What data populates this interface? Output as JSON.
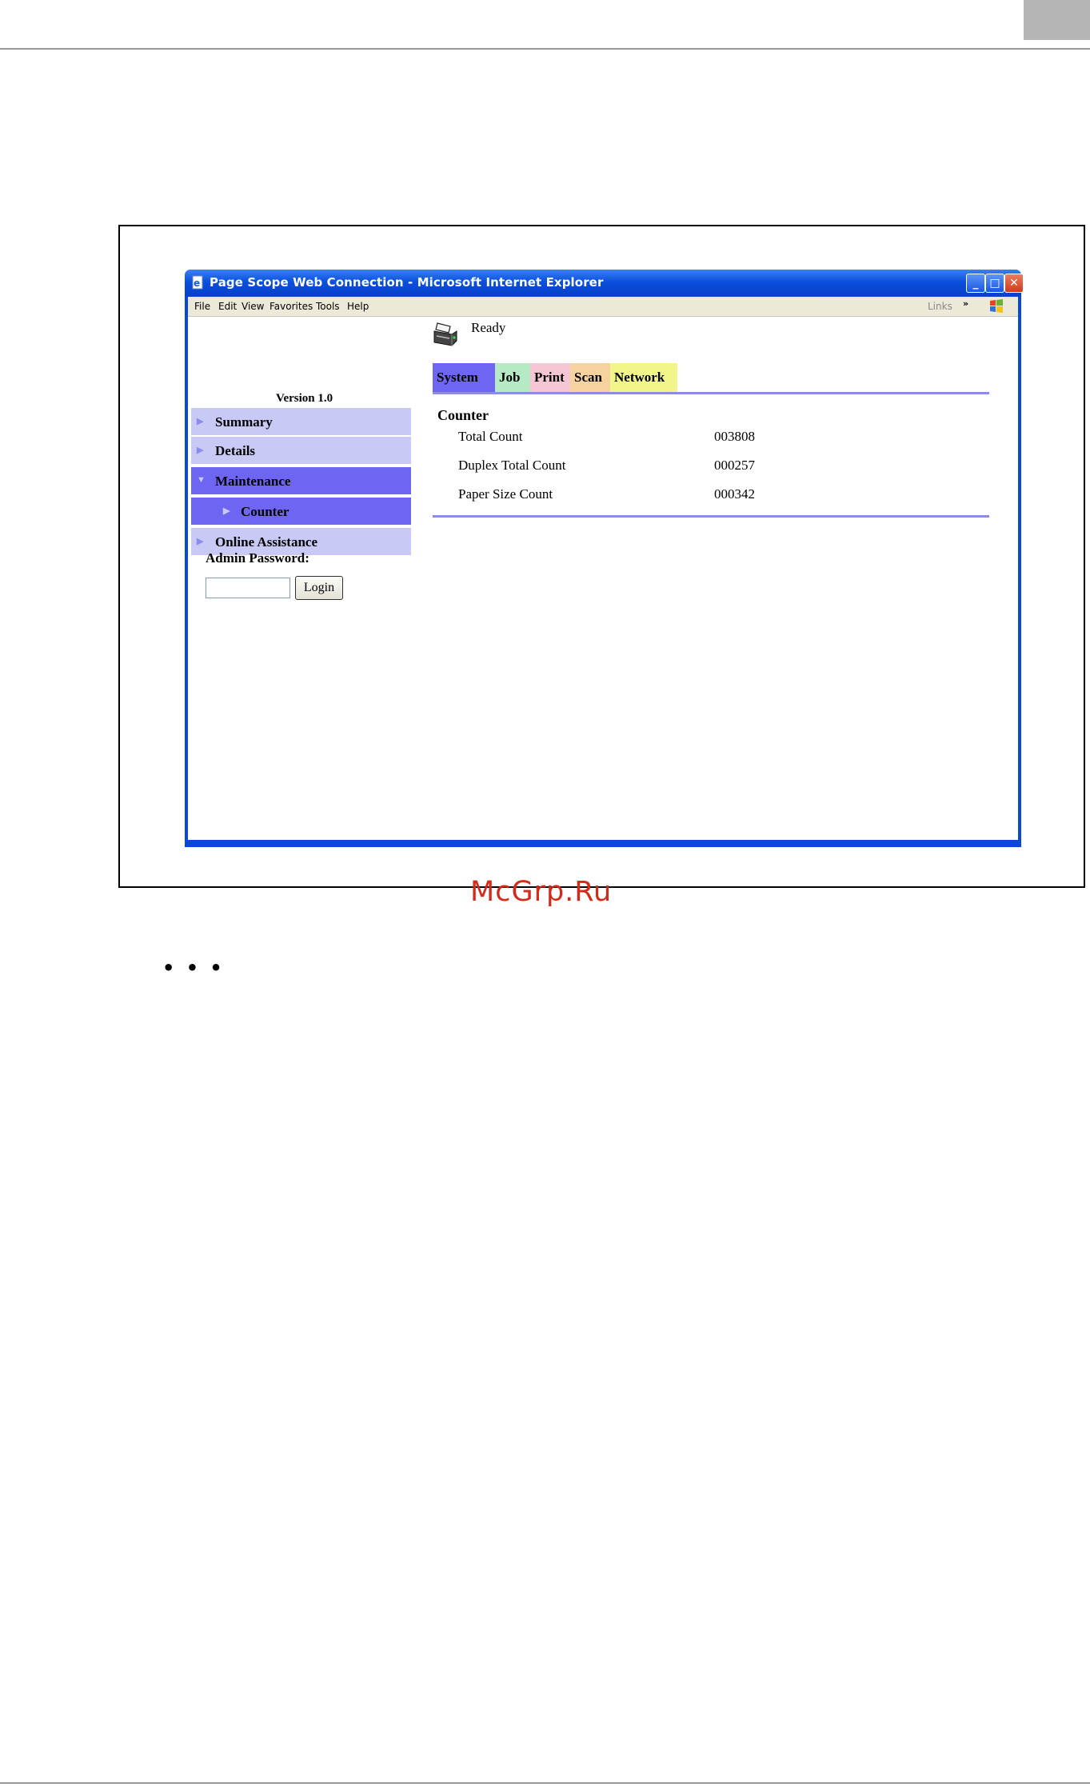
{
  "window": {
    "title": "Page Scope Web Connection - Microsoft Internet Explorer",
    "min_glyph": "_",
    "max_glyph": "□",
    "close_glyph": "✕"
  },
  "menu": {
    "items": [
      "File",
      "Edit",
      "View",
      "Favorites",
      "Tools",
      "Help"
    ],
    "links_label": "Links",
    "chevron": "»"
  },
  "sidebar": {
    "version": "Version 1.0",
    "items": [
      {
        "label": "Summary"
      },
      {
        "label": "Details"
      },
      {
        "label": "Maintenance"
      },
      {
        "label": "Counter"
      },
      {
        "label": "Online Assistance"
      }
    ],
    "admin_label": "Admin Password:",
    "admin_value": "",
    "login_label": "Login"
  },
  "main": {
    "status": "Ready",
    "tabs": [
      "System",
      "Job",
      "Print",
      "Scan",
      "Network"
    ],
    "section_title": "Counter",
    "rows": [
      {
        "label": "Total Count",
        "value": "003808"
      },
      {
        "label": "Duplex Total Count",
        "value": "000257"
      },
      {
        "label": "Paper Size Count",
        "value": "000342"
      }
    ]
  },
  "page": {
    "watermark": "McGrp.Ru",
    "ellipsis": "• • •"
  },
  "colors": {
    "nav_light": "#c9c9f6",
    "nav_active": "#6e65f3",
    "tab_system": "#6e65f3",
    "tab_job": "#b6eac4",
    "tab_print": "#f5c6d4",
    "tab_scan": "#f6d29e",
    "tab_network": "#f2f58a",
    "watermark": "#d32a1a",
    "titlebar": "#0a4fdc"
  },
  "icons": {
    "nav_collapsed": "▶",
    "nav_expanded": "▼"
  }
}
